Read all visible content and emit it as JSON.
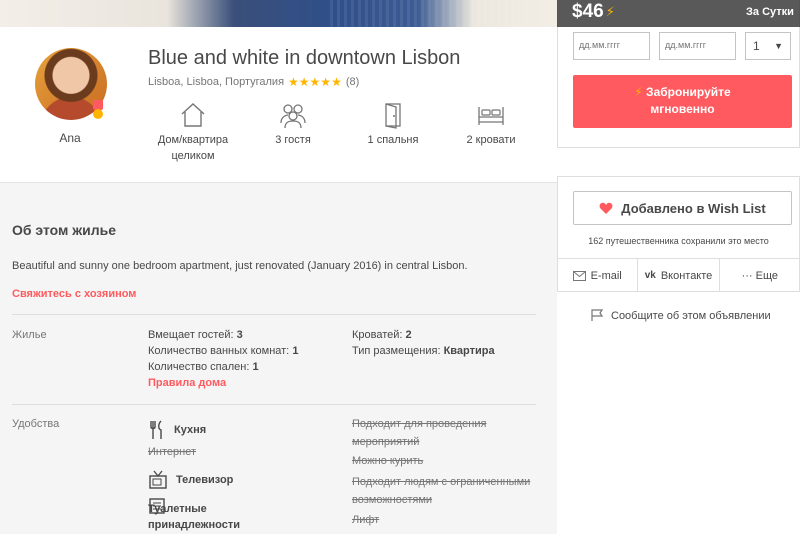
{
  "listing": {
    "title": "Blue and white in downtown Lisbon",
    "location": "Lisboa, Lisboa, Португалия",
    "stars": "★★★★★",
    "reviews": "(8)"
  },
  "host": {
    "name": "Ana"
  },
  "features": [
    {
      "label": "Дом/квартира целиком",
      "icon": "home-icon"
    },
    {
      "label": "3 гостя",
      "icon": "guests-icon"
    },
    {
      "label": "1 спальня",
      "icon": "door-icon"
    },
    {
      "label": "2 кровати",
      "icon": "bed-icon"
    }
  ],
  "about": {
    "title": "Об этом жилье",
    "description": "Beautiful and sunny one bedroom apartment, just renovated (January 2016) in central Lisbon.",
    "contact": "Свяжитесь с хозяином"
  },
  "housing": {
    "label": "Жилье",
    "guests_k": "Вмещает гостей:",
    "guests_v": "3",
    "baths_k": "Количество ванных комнат:",
    "baths_v": "1",
    "bedrooms_k": "Количество спален:",
    "bedrooms_v": "1",
    "rules": "Правила дома",
    "beds_k": "Кроватей:",
    "beds_v": "2",
    "type_k": "Тип размещения:",
    "type_v": "Квартира"
  },
  "amenities": {
    "label": "Удобства",
    "kitchen": "Кухня",
    "internet": "Интернет",
    "tv": "Телевизор",
    "toiletries": "Туалетные принадлежности",
    "events": "Подходит для проведения мероприятий",
    "smoking": "Можно курить",
    "accessible": "Подходит людям с ограниченными возможностями",
    "elevator": "Лифт"
  },
  "booking": {
    "price": "$46",
    "per": "За Сутки",
    "checkin_placeholder": "дд.мм.гггг",
    "checkout_placeholder": "дд.мм.гггг",
    "guests": "1",
    "instant_line1": "Забронируйте",
    "instant_line2": "мгновенно"
  },
  "sidebar": {
    "wishlist": "Добавлено в Wish List",
    "saved": "162 путешественника сохранили это место",
    "email": "E-mail",
    "vk": "Вконтакте",
    "more": "··· Еще",
    "report": "Сообщите об этом объявлении"
  },
  "colors": {
    "accent": "#ff5a5f",
    "star": "#ffb400"
  }
}
